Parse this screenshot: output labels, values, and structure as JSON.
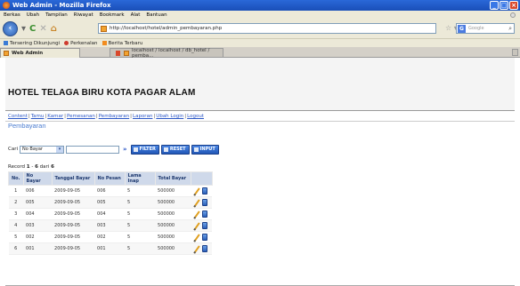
{
  "window": {
    "title": "Web Admin - Mozilla Firefox"
  },
  "menubar": [
    "Berkas",
    "Ubah",
    "Tampilan",
    "Riwayat",
    "Bookmark",
    "Alat",
    "Bantuan"
  ],
  "navbar": {
    "url": "http://localhost/hotel/admin_pembayaran.php",
    "search_placeholder": "Google"
  },
  "bookmarks": [
    "Tersering Dikunjungi",
    "Perkenalan",
    "Berita Terbaru"
  ],
  "tabs": {
    "active": "Web Admin",
    "inactive": "localhost / localhost / db_hotel / pemba..."
  },
  "site": {
    "title": "HOTEL TELAGA BIRU KOTA PAGAR ALAM",
    "menu": [
      "Content",
      "Tamu",
      "Kamar",
      "Pemesanan",
      "Pembayaran",
      "Laporan",
      "Ubah Login",
      "Logout"
    ],
    "page_title": "Pembayaran"
  },
  "search": {
    "label": "Cari",
    "field_value": "No Bayar",
    "input_value": "",
    "go": "»",
    "buttons": {
      "filter": "FILTER",
      "reset": "RESET",
      "input": "INPUT"
    }
  },
  "record": {
    "prefix": "Record",
    "start": "1",
    "dash": "-",
    "end": "6",
    "of": "dari",
    "total": "6"
  },
  "table": {
    "headers": [
      "No.",
      "No Bayar",
      "Tanggal Bayar",
      "No Pesan",
      "Lama Inap",
      "Total Bayar",
      ""
    ],
    "rows": [
      [
        "1",
        "006",
        "2009-09-05",
        "006",
        "5",
        "500000"
      ],
      [
        "2",
        "005",
        "2009-09-05",
        "005",
        "5",
        "500000"
      ],
      [
        "3",
        "004",
        "2009-09-05",
        "004",
        "5",
        "500000"
      ],
      [
        "4",
        "003",
        "2009-09-05",
        "003",
        "5",
        "500000"
      ],
      [
        "5",
        "002",
        "2009-09-05",
        "002",
        "5",
        "500000"
      ],
      [
        "6",
        "001",
        "2009-09-05",
        "001",
        "5",
        "500000"
      ]
    ]
  }
}
